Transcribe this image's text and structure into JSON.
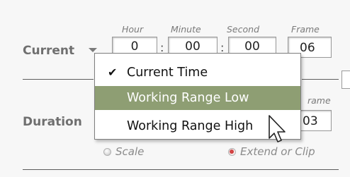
{
  "timecode_headers": {
    "hour": "Hour",
    "minute": "Minute",
    "second": "Second",
    "frame": "Frame",
    "frame_partial": "rame"
  },
  "current": {
    "label": "Current",
    "hour": "0",
    "minute": "00",
    "second": "00",
    "frame": "06"
  },
  "duration": {
    "label": "Duration",
    "frame": "03"
  },
  "separator": ":",
  "menu": {
    "items": [
      {
        "label": "Current Time",
        "checked": true,
        "highlighted": false
      },
      {
        "label": "Working Range Low",
        "checked": false,
        "highlighted": true
      },
      {
        "label": "Working Range High",
        "checked": false,
        "highlighted": false
      }
    ],
    "check_glyph": "✔"
  },
  "options": {
    "scale_label": "Scale",
    "extend_label": "Extend or Clip",
    "selected": "Extend or Clip"
  },
  "colors": {
    "highlight": "#8e9e73",
    "radio_selected": "#c83434"
  },
  "icons": [
    "chevron-down-icon",
    "checkmark-icon",
    "mouse-pointer-icon"
  ]
}
